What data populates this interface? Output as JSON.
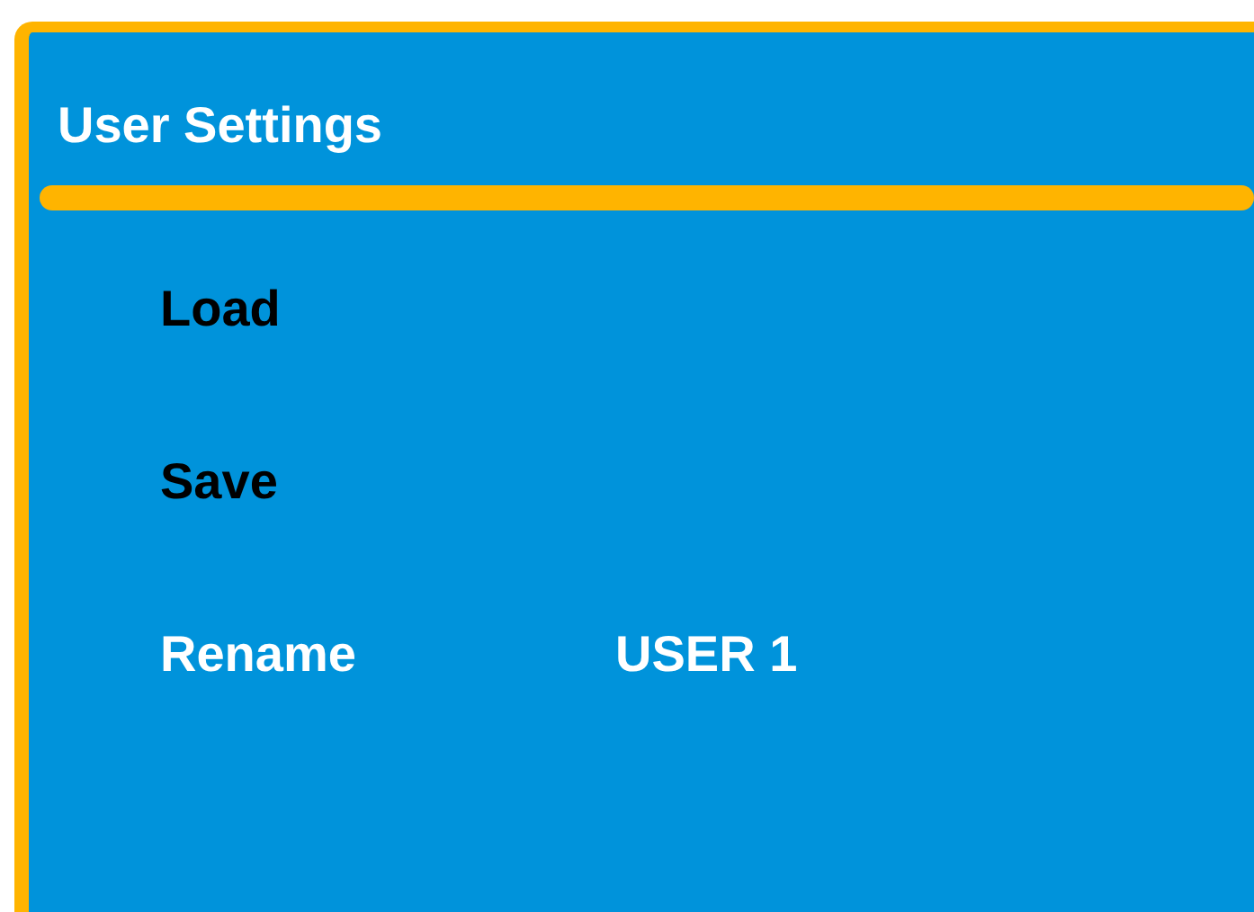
{
  "title": "User Settings",
  "items": [
    {
      "label": "Load",
      "selected": false
    },
    {
      "label": "Save",
      "selected": false
    },
    {
      "label": "Rename",
      "selected": true,
      "value": "USER 1"
    }
  ]
}
